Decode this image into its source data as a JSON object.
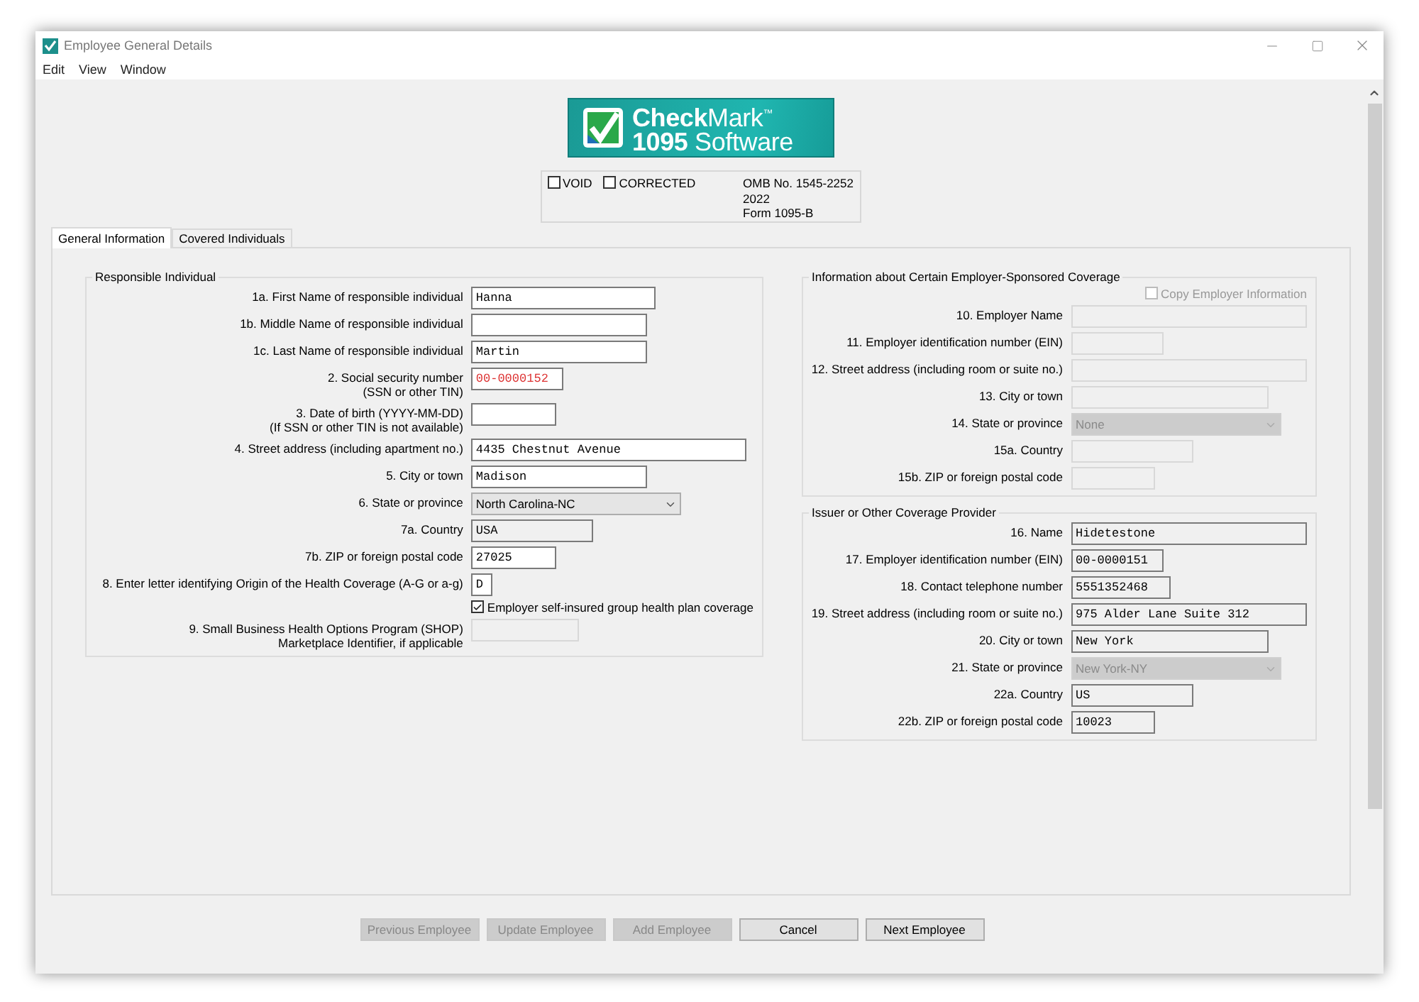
{
  "window": {
    "title": "Employee General Details"
  },
  "menu": [
    "Edit",
    "View",
    "Window"
  ],
  "logo": {
    "line1": "**Check**Mark$^{™}$",
    "line2": "**1095** Software"
  },
  "form_box": {
    "checkboxes": [
      {
        "label": "VOID",
        "checked": false
      },
      {
        "label": "CORRECTED",
        "checked": false
      }
    ],
    "lines": [
      "OMB No. 1545-2252",
      "2022",
      "Form 1095-B"
    ]
  },
  "tabs": [
    {
      "label": "General Information",
      "selected": true
    },
    {
      "label": "Covered Individuals",
      "selected": false
    }
  ],
  "responsible_individual": {
    "title": "Responsible Individual",
    "fields": [
      {
        "kind": "text",
        "label": "1a. First Name of responsible individual",
        "value": "Hanna",
        "disabled": false,
        "readonly": false
      },
      {
        "kind": "text",
        "label": "1b. Middle Name of responsible individual",
        "disabled": false,
        "readonly": false
      },
      {
        "kind": "text",
        "label": "1c. Last Name of responsible individual",
        "value": "Martin",
        "disabled": false,
        "readonly": false
      },
      {
        "kind": "text",
        "label": "2. Social security number\n(SSN or other TIN)",
        "value": "00-0000152",
        "disabled": false,
        "readonly": false,
        "invalid": true
      },
      {
        "kind": "text",
        "label": "3. Date of birth (YYYY-MM-DD)\n(If SSN or other TIN is not available)",
        "disabled": false,
        "readonly": false
      },
      {
        "kind": "text",
        "label": "4. Street address (including apartment no.)",
        "value": "4435 Chestnut Avenue",
        "disabled": false,
        "readonly": false
      },
      {
        "kind": "text",
        "label": "5. City or town",
        "value": "Madison",
        "disabled": false,
        "readonly": false
      },
      {
        "kind": "select",
        "label": "6. State or province",
        "value": "North Carolina-NC",
        "disabled": false
      },
      {
        "kind": "text",
        "label": "7a. Country",
        "value": "USA",
        "disabled": false,
        "readonly": true
      },
      {
        "kind": "text",
        "label": "7b. ZIP or foreign postal code",
        "value": "27025",
        "disabled": false,
        "readonly": false
      },
      {
        "kind": "text",
        "label": "8. Enter letter identifying Origin of the Health Coverage (A-G or a-g)",
        "value": "D",
        "disabled": false,
        "readonly": false
      },
      {
        "kind": "checkbox",
        "label": "Employer self-insured group health plan coverage",
        "checked": true,
        "disabled": false
      },
      {
        "kind": "text",
        "label": "9. Small Business Health Options Program (SHOP)\nMarketplace Identifier, if applicable",
        "disabled": true
      }
    ]
  },
  "employer_coverage": {
    "title": "Information about Certain Employer-Sponsored Coverage",
    "fields": [
      {
        "kind": "checkbox",
        "label": "Copy Employer Information",
        "checked": false,
        "disabled": true
      },
      {
        "kind": "text",
        "label": "10. Employer Name",
        "disabled": true
      },
      {
        "kind": "text",
        "label": "11. Employer identification number (EIN)",
        "disabled": true
      },
      {
        "kind": "text",
        "label": "12. Street address (including room or suite no.)",
        "disabled": true
      },
      {
        "kind": "text",
        "label": "13. City or town",
        "disabled": true
      },
      {
        "kind": "select",
        "label": "14. State or province",
        "value": "None",
        "disabled": true
      },
      {
        "kind": "text",
        "label": "15a. Country",
        "disabled": true
      },
      {
        "kind": "text",
        "label": "15b. ZIP or foreign postal code",
        "disabled": true
      }
    ]
  },
  "issuer": {
    "title": "Issuer or Other Coverage Provider",
    "fields": [
      {
        "kind": "text",
        "label": "16. Name",
        "value": "Hidetestone",
        "disabled": false,
        "readonly": true
      },
      {
        "kind": "text",
        "label": "17. Employer identification number (EIN)",
        "value": "00-0000151",
        "disabled": false,
        "readonly": true
      },
      {
        "kind": "text",
        "label": "18. Contact telephone number",
        "value": "5551352468",
        "disabled": false,
        "readonly": true
      },
      {
        "kind": "text",
        "label": "19. Street address (including room or suite no.)",
        "value": "975 Alder Lane Suite 312",
        "disabled": false,
        "readonly": true
      },
      {
        "kind": "text",
        "label": "20. City or town",
        "value": "New York",
        "disabled": false,
        "readonly": true
      },
      {
        "kind": "select",
        "label": "21. State or province",
        "value": "New York-NY",
        "disabled": true
      },
      {
        "kind": "text",
        "label": "22a. Country",
        "value": "US",
        "disabled": false,
        "readonly": true
      },
      {
        "kind": "text",
        "label": "22b. ZIP or foreign postal code",
        "value": "10023",
        "disabled": false,
        "readonly": true
      }
    ]
  },
  "buttons": [
    {
      "label": "Previous Employee",
      "disabled": true
    },
    {
      "label": "Update Employee",
      "disabled": true
    },
    {
      "label": "Add Employee",
      "disabled": true
    },
    {
      "label": "Cancel",
      "disabled": false
    },
    {
      "label": "Next Employee",
      "disabled": false
    }
  ]
}
